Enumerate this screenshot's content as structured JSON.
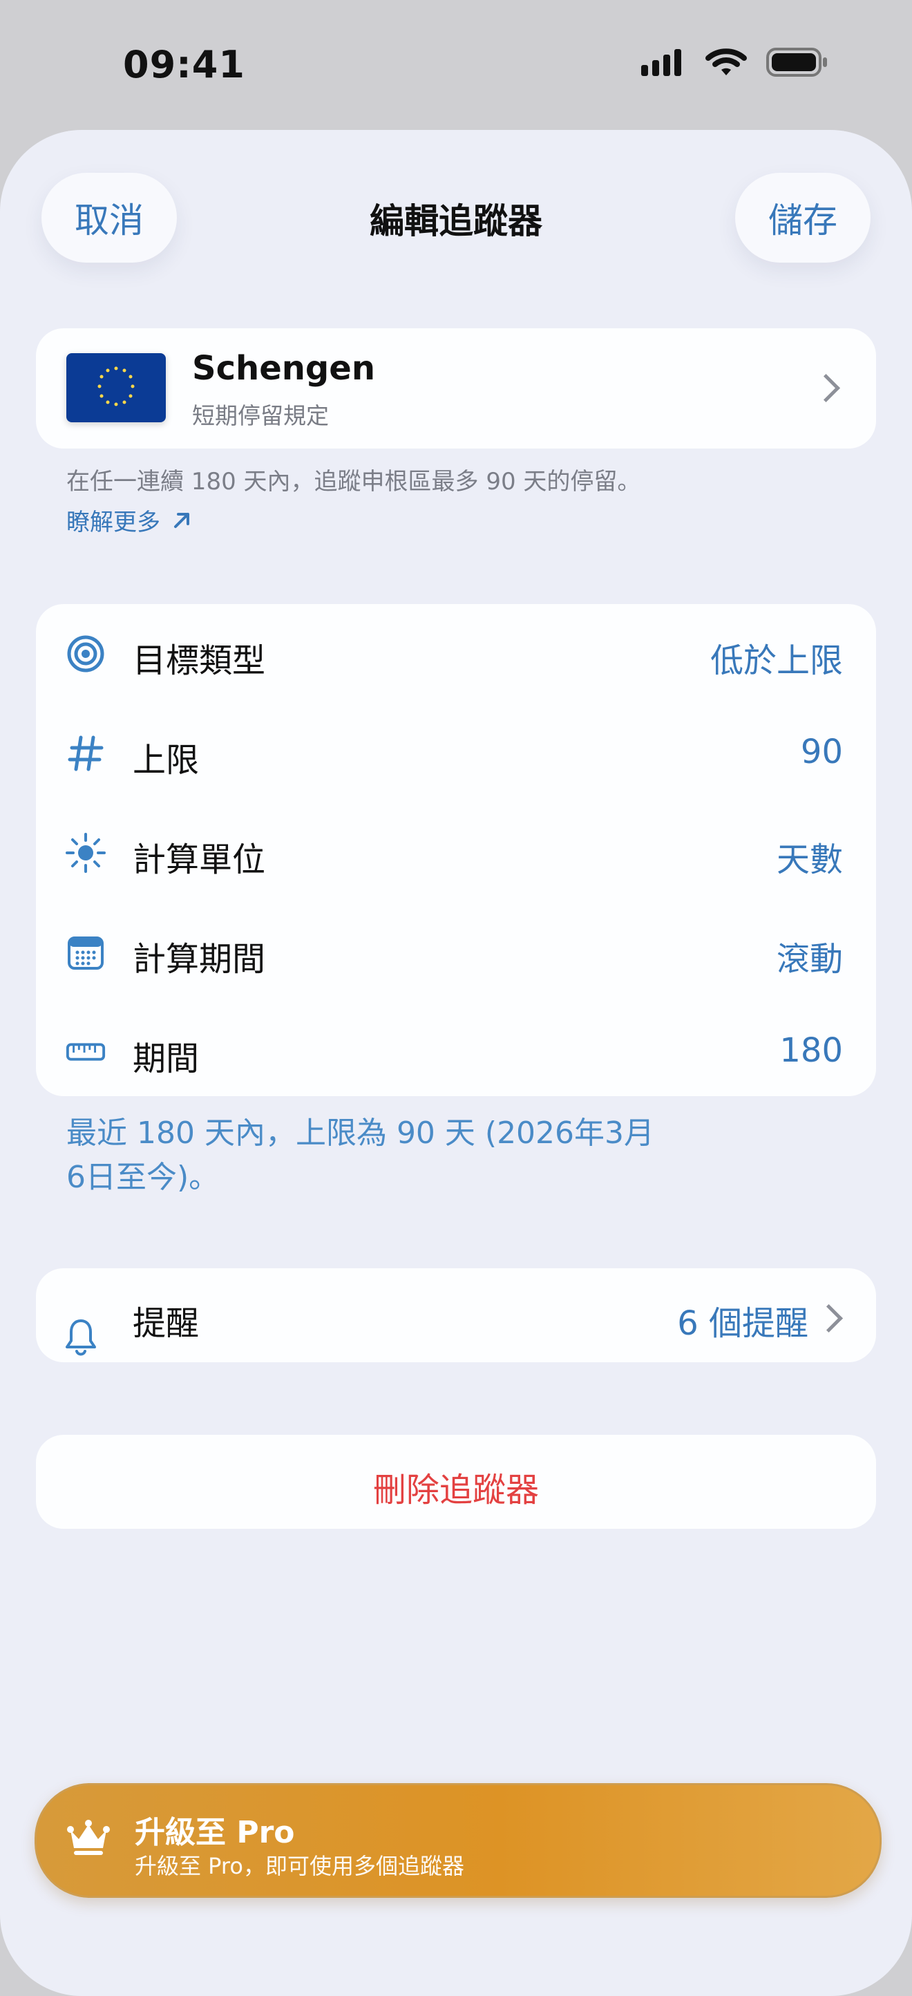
{
  "status_bar": {
    "time": "09:41"
  },
  "header": {
    "cancel_label": "取消",
    "title": "編輯追蹤器",
    "save_label": "儲存"
  },
  "rule": {
    "title": "Schengen",
    "subtitle": "短期停留規定",
    "description": "在任一連續 180 天內，追蹤申根區最多 90 天的停留。",
    "learn_more": "瞭解更多"
  },
  "settings": [
    {
      "icon": "target-icon",
      "label": "目標類型",
      "value": "低於上限"
    },
    {
      "icon": "hash-icon",
      "label": "上限",
      "value": "90"
    },
    {
      "icon": "sun-icon",
      "label": "計算單位",
      "value": "天數"
    },
    {
      "icon": "calendar-icon",
      "label": "計算期間",
      "value": "滾動"
    },
    {
      "icon": "ruler-icon",
      "label": "期間",
      "value": "180"
    }
  ],
  "summary": {
    "line_1": "最近 180 天內，上限為 90 天 (2026年3月",
    "line_2": "6日至今)。"
  },
  "reminders": {
    "label": "提醒",
    "value": "6 個提醒"
  },
  "delete": {
    "label": "刪除追蹤器"
  },
  "upgrade": {
    "title": "升級至 Pro",
    "subtitle": "升級至 Pro，即可使用多個追蹤器"
  },
  "colors": {
    "accent": "#3878ba",
    "background": "#eceef7",
    "card": "#fdfeff",
    "danger": "#e34141",
    "upgrade": "#dd9325"
  }
}
